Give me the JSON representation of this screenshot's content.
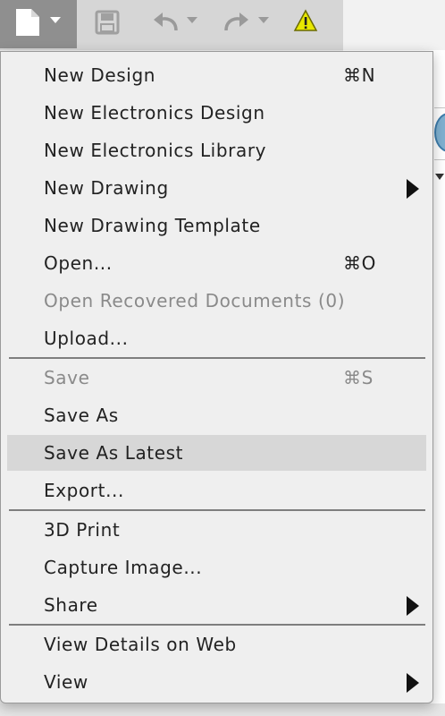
{
  "toolbar": {
    "buttons": [
      {
        "name": "file-menu",
        "icon": "document-icon",
        "dropdown": true,
        "active": true
      },
      {
        "name": "save",
        "icon": "save-icon"
      },
      {
        "name": "undo",
        "icon": "undo-icon",
        "dropdown": true
      },
      {
        "name": "redo",
        "icon": "redo-icon",
        "dropdown": true
      },
      {
        "name": "warning",
        "icon": "warning-icon",
        "color": "#e8e800"
      }
    ]
  },
  "menu": {
    "groups": [
      [
        {
          "label": "New Design",
          "shortcut": "⌘N"
        },
        {
          "label": "New Electronics Design"
        },
        {
          "label": "New Electronics Library"
        },
        {
          "label": "New Drawing",
          "submenu": true
        },
        {
          "label": "New Drawing Template"
        },
        {
          "label": "Open...",
          "shortcut": "⌘O"
        },
        {
          "label": "Open Recovered Documents (0)",
          "disabled": true
        },
        {
          "label": "Upload..."
        }
      ],
      [
        {
          "label": "Save",
          "shortcut": "⌘S",
          "disabled": true
        },
        {
          "label": "Save As"
        },
        {
          "label": "Save As Latest",
          "highlighted": true
        },
        {
          "label": "Export..."
        }
      ],
      [
        {
          "label": "3D Print"
        },
        {
          "label": "Capture Image..."
        },
        {
          "label": "Share",
          "submenu": true
        }
      ],
      [
        {
          "label": "View Details on Web"
        },
        {
          "label": "View",
          "submenu": true
        }
      ]
    ]
  },
  "colors": {
    "menu_bg": "#efefef",
    "highlight": "#d7d7d7",
    "disabled_text": "#8a8a8a",
    "active_button": "#8f8f8f"
  }
}
